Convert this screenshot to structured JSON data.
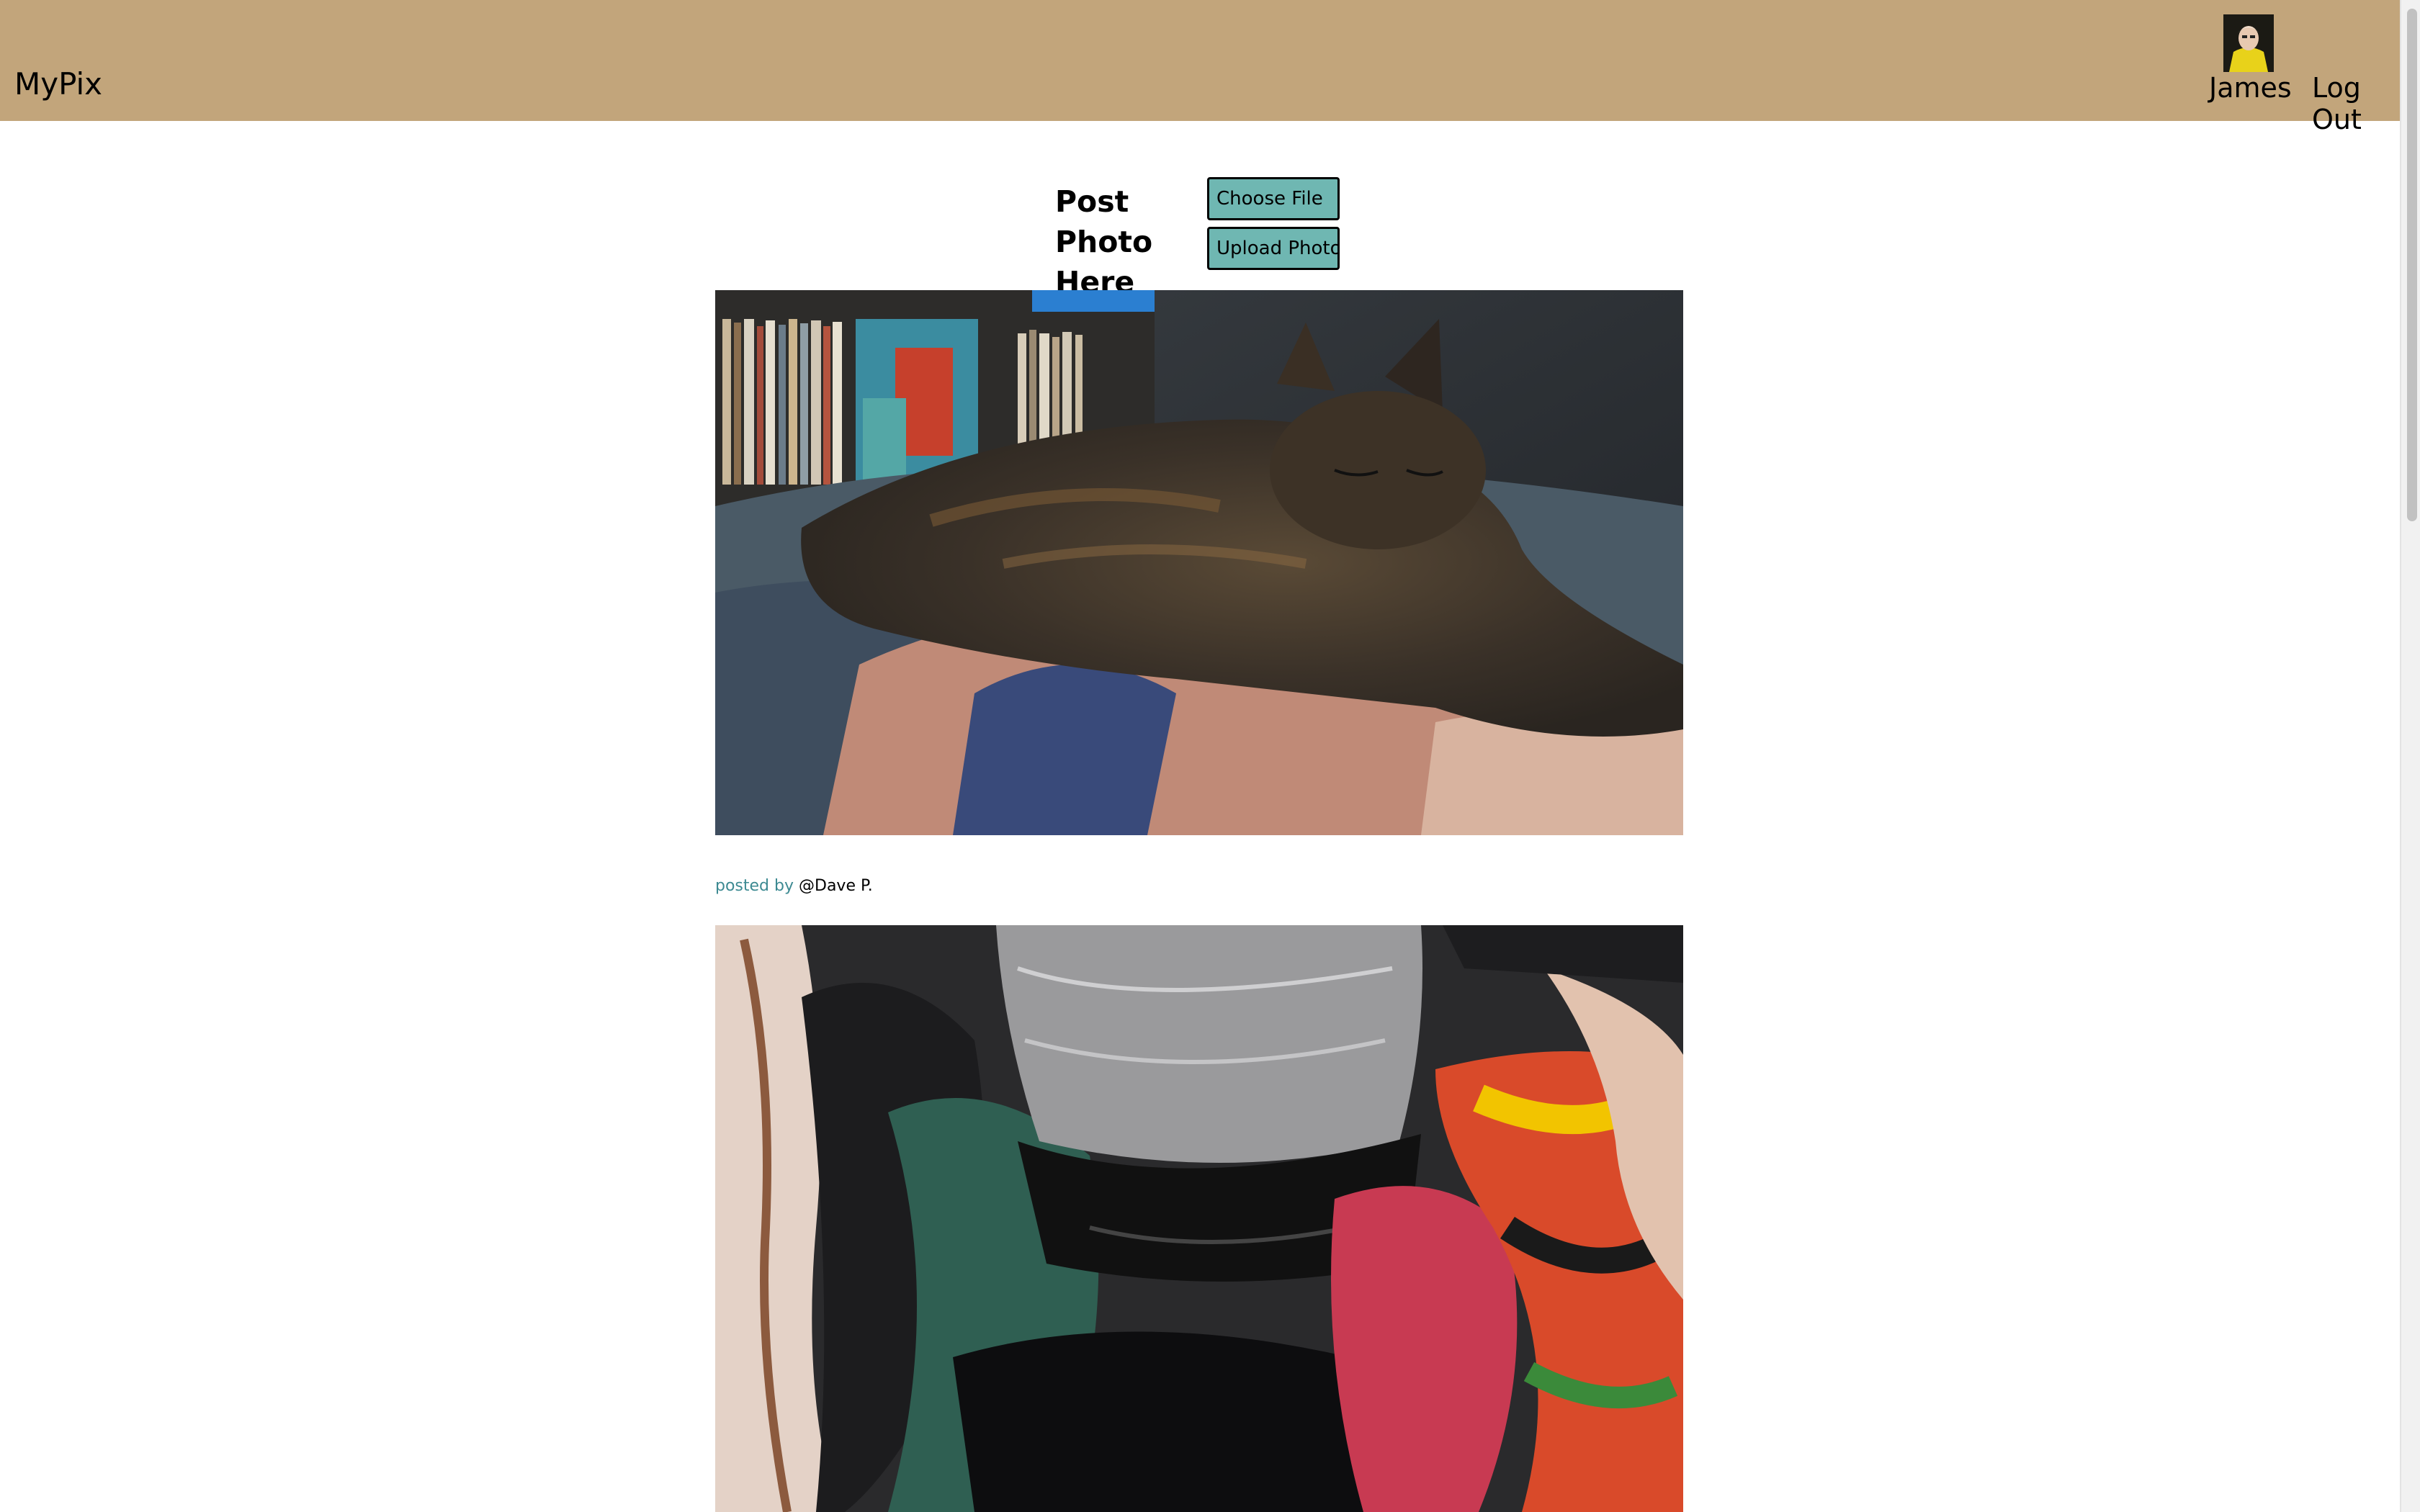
{
  "header": {
    "brand": "MyPix",
    "username": "James",
    "logout_label": "Log Out",
    "background_color": "#c2a57b"
  },
  "upload": {
    "title": "Post Photo Here",
    "choose_file_label": "Choose File",
    "upload_label": "Upload Photo",
    "button_color": "#6fb7b2"
  },
  "posts": [
    {
      "posted_by_label": "posted by",
      "author": "@Dave P."
    }
  ],
  "accent_color": "#3d8a92"
}
